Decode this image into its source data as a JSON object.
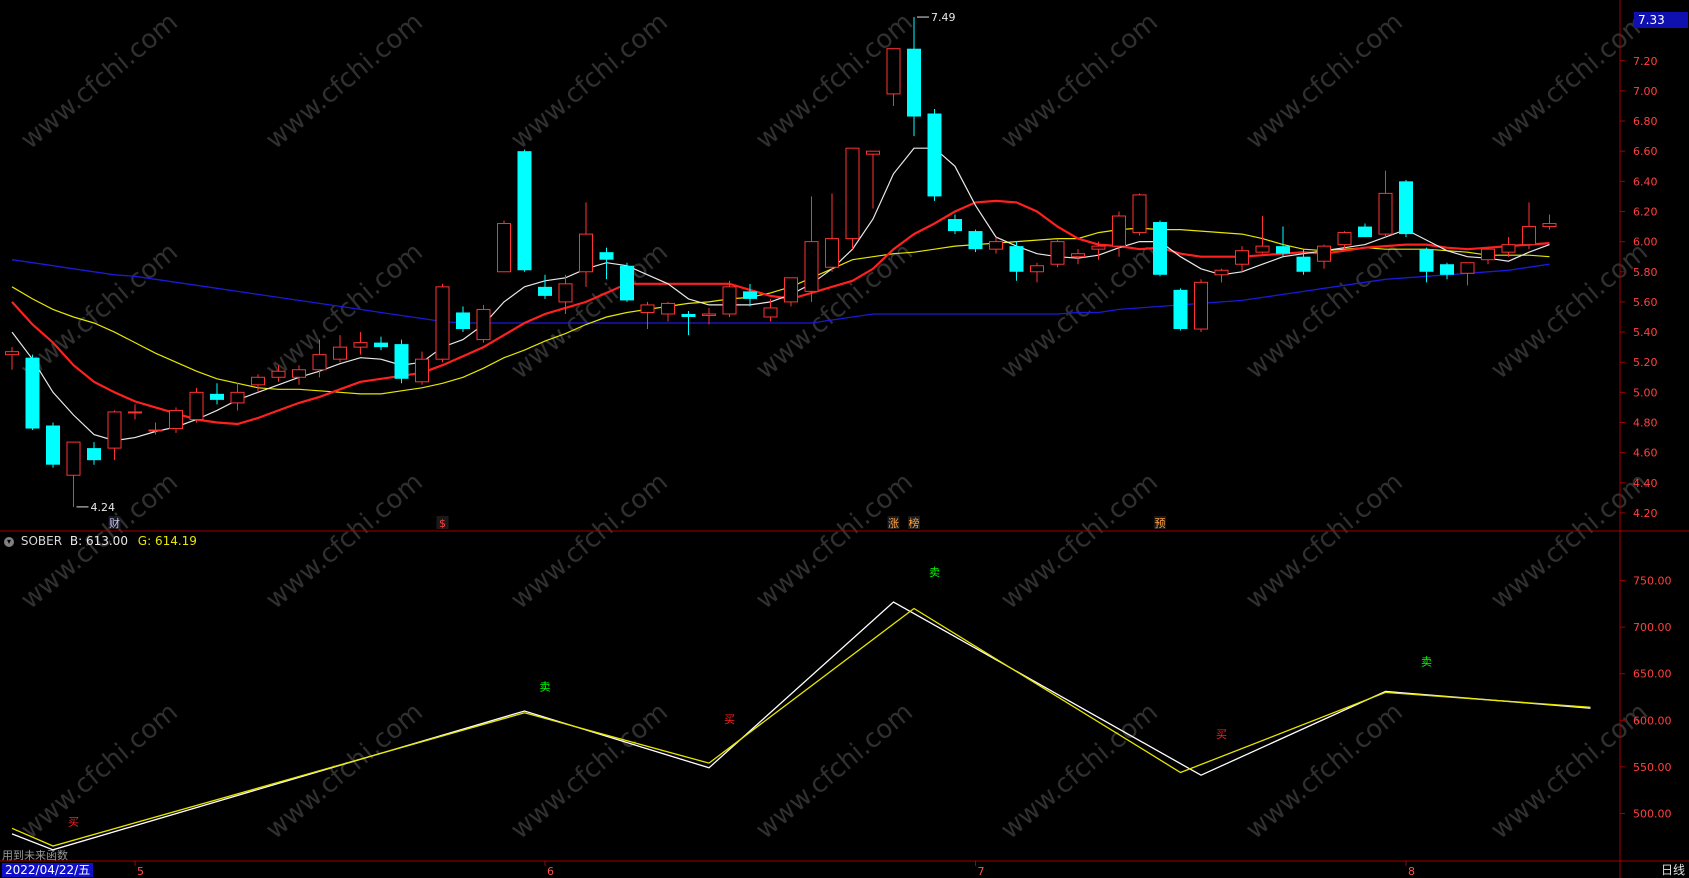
{
  "ind_header": {
    "name": "SOBER",
    "b_label": "B: 613.00",
    "g_label": "G: 614.19"
  },
  "footer": {
    "date": "2022/04/22/五",
    "hint": "用到未来函数",
    "period": "日线"
  },
  "price_tag": "7.33",
  "colors": {
    "up": "#ff3232",
    "down": "#00ffff",
    "ma5": "#e8e8e8",
    "ma10": "#ff2020",
    "ma20": "#e6e600",
    "ma60": "#1a1ad8",
    "axis": "#a00000",
    "sober_b": "#ffffff",
    "sober_g": "#e6e600",
    "buy": "#ff2020",
    "sell": "#00ff00"
  },
  "chart_data": [
    {
      "type": "candlestick",
      "title": "",
      "ylim": [
        4.1,
        7.55
      ],
      "y_ticks": [
        4.2,
        4.4,
        4.6,
        4.8,
        5.0,
        5.2,
        5.4,
        5.6,
        5.8,
        6.0,
        6.2,
        6.4,
        6.6,
        6.8,
        7.0,
        7.2
      ],
      "y_tick_labels": [
        "4.20",
        "4.40",
        "4.60",
        "4.80",
        "5.00",
        "5.20",
        "5.40",
        "5.60",
        "5.80",
        "6.00",
        "6.20",
        "6.40",
        "6.60",
        "6.80",
        "7.00",
        "7.20"
      ],
      "x_labels": [
        {
          "i": 6,
          "label": "5"
        },
        {
          "i": 26,
          "label": "6"
        },
        {
          "i": 47,
          "label": "7"
        },
        {
          "i": 68,
          "label": "8"
        }
      ],
      "candles": [
        {
          "o": 5.25,
          "h": 5.3,
          "l": 5.15,
          "c": 5.27
        },
        {
          "o": 5.23,
          "h": 5.25,
          "l": 4.75,
          "c": 4.76
        },
        {
          "o": 4.78,
          "h": 4.8,
          "l": 4.5,
          "c": 4.52
        },
        {
          "o": 4.45,
          "h": 4.67,
          "l": 4.24,
          "c": 4.67
        },
        {
          "o": 4.63,
          "h": 4.67,
          "l": 4.52,
          "c": 4.55
        },
        {
          "o": 4.63,
          "h": 4.88,
          "l": 4.55,
          "c": 4.87
        },
        {
          "o": 4.87,
          "h": 4.92,
          "l": 4.82,
          "c": 4.87
        },
        {
          "o": 4.75,
          "h": 4.8,
          "l": 4.72,
          "c": 4.75
        },
        {
          "o": 4.76,
          "h": 4.9,
          "l": 4.73,
          "c": 4.88
        },
        {
          "o": 4.82,
          "h": 5.03,
          "l": 4.8,
          "c": 5.0
        },
        {
          "o": 4.99,
          "h": 5.06,
          "l": 4.92,
          "c": 4.95
        },
        {
          "o": 4.93,
          "h": 5.06,
          "l": 4.88,
          "c": 5.0
        },
        {
          "o": 5.05,
          "h": 5.12,
          "l": 5.0,
          "c": 5.1
        },
        {
          "o": 5.1,
          "h": 5.18,
          "l": 5.07,
          "c": 5.14
        },
        {
          "o": 5.1,
          "h": 5.18,
          "l": 5.05,
          "c": 5.15
        },
        {
          "o": 5.15,
          "h": 5.35,
          "l": 5.1,
          "c": 5.25
        },
        {
          "o": 5.22,
          "h": 5.38,
          "l": 5.2,
          "c": 5.3
        },
        {
          "o": 5.3,
          "h": 5.4,
          "l": 5.25,
          "c": 5.33
        },
        {
          "o": 5.33,
          "h": 5.37,
          "l": 5.28,
          "c": 5.3
        },
        {
          "o": 5.32,
          "h": 5.35,
          "l": 5.06,
          "c": 5.09
        },
        {
          "o": 5.07,
          "h": 5.27,
          "l": 5.05,
          "c": 5.22
        },
        {
          "o": 5.22,
          "h": 5.72,
          "l": 5.2,
          "c": 5.7
        },
        {
          "o": 5.53,
          "h": 5.57,
          "l": 5.4,
          "c": 5.42
        },
        {
          "o": 5.35,
          "h": 5.58,
          "l": 5.33,
          "c": 5.55
        },
        {
          "o": 5.8,
          "h": 6.14,
          "l": 5.8,
          "c": 6.12
        },
        {
          "o": 6.6,
          "h": 6.61,
          "l": 5.8,
          "c": 5.81
        },
        {
          "o": 5.7,
          "h": 5.78,
          "l": 5.62,
          "c": 5.64
        },
        {
          "o": 5.6,
          "h": 5.78,
          "l": 5.52,
          "c": 5.72
        },
        {
          "o": 5.8,
          "h": 6.26,
          "l": 5.7,
          "c": 6.05
        },
        {
          "o": 5.93,
          "h": 5.96,
          "l": 5.75,
          "c": 5.88
        },
        {
          "o": 5.84,
          "h": 5.86,
          "l": 5.6,
          "c": 5.61
        },
        {
          "o": 5.53,
          "h": 5.6,
          "l": 5.42,
          "c": 5.58
        },
        {
          "o": 5.52,
          "h": 5.6,
          "l": 5.47,
          "c": 5.59
        },
        {
          "o": 5.52,
          "h": 5.54,
          "l": 5.38,
          "c": 5.5
        },
        {
          "o": 5.51,
          "h": 5.56,
          "l": 5.45,
          "c": 5.52
        },
        {
          "o": 5.52,
          "h": 5.74,
          "l": 5.5,
          "c": 5.7
        },
        {
          "o": 5.67,
          "h": 5.72,
          "l": 5.57,
          "c": 5.62
        },
        {
          "o": 5.5,
          "h": 5.62,
          "l": 5.47,
          "c": 5.56
        },
        {
          "o": 5.6,
          "h": 5.76,
          "l": 5.57,
          "c": 5.76
        },
        {
          "o": 5.67,
          "h": 6.3,
          "l": 5.6,
          "c": 6.0
        },
        {
          "o": 5.83,
          "h": 6.32,
          "l": 5.8,
          "c": 6.02
        },
        {
          "o": 6.02,
          "h": 6.26,
          "l": 5.95,
          "c": 6.62
        },
        {
          "o": 6.58,
          "h": 6.55,
          "l": 6.22,
          "c": 6.6
        },
        {
          "o": 6.98,
          "h": 7.28,
          "l": 6.9,
          "c": 7.28
        },
        {
          "o": 7.28,
          "h": 7.49,
          "l": 6.7,
          "c": 6.83
        },
        {
          "o": 6.85,
          "h": 6.88,
          "l": 6.27,
          "c": 6.3
        },
        {
          "o": 6.15,
          "h": 6.18,
          "l": 6.05,
          "c": 6.07
        },
        {
          "o": 6.07,
          "h": 6.08,
          "l": 5.93,
          "c": 5.95
        },
        {
          "o": 5.95,
          "h": 6.03,
          "l": 5.92,
          "c": 6.0
        },
        {
          "o": 5.97,
          "h": 6.0,
          "l": 5.74,
          "c": 5.8
        },
        {
          "o": 5.8,
          "h": 5.86,
          "l": 5.73,
          "c": 5.84
        },
        {
          "o": 5.85,
          "h": 6.02,
          "l": 5.83,
          "c": 6.0
        },
        {
          "o": 5.9,
          "h": 5.95,
          "l": 5.85,
          "c": 5.92
        },
        {
          "o": 5.95,
          "h": 6.0,
          "l": 5.88,
          "c": 5.97
        },
        {
          "o": 5.97,
          "h": 6.2,
          "l": 5.9,
          "c": 6.17
        },
        {
          "o": 6.06,
          "h": 6.32,
          "l": 6.04,
          "c": 6.31
        },
        {
          "o": 6.13,
          "h": 6.14,
          "l": 5.77,
          "c": 5.78
        },
        {
          "o": 5.68,
          "h": 5.69,
          "l": 5.41,
          "c": 5.42
        },
        {
          "o": 5.42,
          "h": 5.75,
          "l": 5.4,
          "c": 5.73
        },
        {
          "o": 5.78,
          "h": 5.82,
          "l": 5.73,
          "c": 5.81
        },
        {
          "o": 5.85,
          "h": 5.97,
          "l": 5.8,
          "c": 5.94
        },
        {
          "o": 5.93,
          "h": 6.17,
          "l": 5.92,
          "c": 5.97
        },
        {
          "o": 5.97,
          "h": 6.1,
          "l": 5.9,
          "c": 5.92
        },
        {
          "o": 5.9,
          "h": 5.95,
          "l": 5.78,
          "c": 5.8
        },
        {
          "o": 5.87,
          "h": 5.98,
          "l": 5.82,
          "c": 5.97
        },
        {
          "o": 5.98,
          "h": 6.07,
          "l": 5.95,
          "c": 6.06
        },
        {
          "o": 6.1,
          "h": 6.12,
          "l": 6.03,
          "c": 6.03
        },
        {
          "o": 6.05,
          "h": 6.47,
          "l": 6.03,
          "c": 6.32
        },
        {
          "o": 6.4,
          "h": 6.41,
          "l": 6.03,
          "c": 6.05
        },
        {
          "o": 5.95,
          "h": 5.96,
          "l": 5.73,
          "c": 5.8
        },
        {
          "o": 5.85,
          "h": 5.86,
          "l": 5.75,
          "c": 5.78
        },
        {
          "o": 5.79,
          "h": 5.86,
          "l": 5.71,
          "c": 5.86
        },
        {
          "o": 5.88,
          "h": 5.96,
          "l": 5.85,
          "c": 5.95
        },
        {
          "o": 5.93,
          "h": 6.03,
          "l": 5.9,
          "c": 5.98
        },
        {
          "o": 5.98,
          "h": 6.26,
          "l": 5.95,
          "c": 6.1
        },
        {
          "o": 6.1,
          "h": 6.18,
          "l": 6.08,
          "c": 6.12
        }
      ],
      "ma5": [
        5.4,
        5.22,
        5.0,
        4.85,
        4.72,
        4.68,
        4.7,
        4.74,
        4.77,
        4.82,
        4.88,
        4.95,
        5.0,
        5.05,
        5.1,
        5.14,
        5.19,
        5.23,
        5.22,
        5.18,
        5.2,
        5.3,
        5.35,
        5.45,
        5.6,
        5.7,
        5.74,
        5.76,
        5.82,
        5.86,
        5.84,
        5.78,
        5.72,
        5.62,
        5.58,
        5.58,
        5.58,
        5.6,
        5.65,
        5.72,
        5.82,
        5.95,
        6.15,
        6.45,
        6.62,
        6.62,
        6.5,
        6.24,
        6.03,
        5.97,
        5.92,
        5.9,
        5.89,
        5.91,
        5.96,
        6.0,
        6.0,
        5.9,
        5.82,
        5.78,
        5.8,
        5.85,
        5.9,
        5.92,
        5.94,
        5.96,
        5.98,
        6.03,
        6.08,
        6.01,
        5.94,
        5.9,
        5.89,
        5.87,
        5.93,
        5.98
      ],
      "ma10": [
        5.6,
        5.45,
        5.33,
        5.18,
        5.07,
        5.0,
        4.94,
        4.9,
        4.86,
        4.82,
        4.8,
        4.79,
        4.83,
        4.88,
        4.93,
        4.97,
        5.02,
        5.07,
        5.09,
        5.11,
        5.13,
        5.18,
        5.24,
        5.3,
        5.38,
        5.46,
        5.52,
        5.56,
        5.6,
        5.66,
        5.72,
        5.72,
        5.72,
        5.72,
        5.72,
        5.72,
        5.68,
        5.64,
        5.62,
        5.66,
        5.7,
        5.74,
        5.82,
        5.95,
        6.05,
        6.12,
        6.2,
        6.26,
        6.27,
        6.26,
        6.2,
        6.1,
        6.02,
        5.98,
        5.97,
        5.95,
        5.96,
        5.92,
        5.9,
        5.9,
        5.9,
        5.91,
        5.92,
        5.93,
        5.92,
        5.94,
        5.96,
        5.97,
        5.98,
        5.98,
        5.96,
        5.95,
        5.96,
        5.97,
        5.98,
        5.99
      ],
      "ma20": [
        5.7,
        5.62,
        5.55,
        5.5,
        5.46,
        5.4,
        5.33,
        5.26,
        5.2,
        5.14,
        5.09,
        5.06,
        5.03,
        5.02,
        5.02,
        5.01,
        5.0,
        4.99,
        4.99,
        5.01,
        5.03,
        5.06,
        5.1,
        5.16,
        5.23,
        5.28,
        5.34,
        5.39,
        5.45,
        5.5,
        5.53,
        5.55,
        5.57,
        5.59,
        5.6,
        5.62,
        5.63,
        5.66,
        5.7,
        5.76,
        5.82,
        5.88,
        5.9,
        5.92,
        5.93,
        5.95,
        5.97,
        5.98,
        5.99,
        6.0,
        6.01,
        6.02,
        6.02,
        6.06,
        6.08,
        6.09,
        6.08,
        6.08,
        6.07,
        6.06,
        6.05,
        6.02,
        5.98,
        5.95,
        5.94,
        5.95,
        5.96,
        5.95,
        5.95,
        5.95,
        5.94,
        5.93,
        5.91,
        5.91,
        5.91,
        5.9
      ],
      "ma60": [
        5.88,
        5.86,
        5.84,
        5.82,
        5.8,
        5.78,
        5.77,
        5.75,
        5.73,
        5.71,
        5.69,
        5.67,
        5.65,
        5.63,
        5.61,
        5.59,
        5.57,
        5.55,
        5.53,
        5.51,
        5.49,
        5.47,
        5.46,
        5.46,
        5.46,
        5.46,
        5.46,
        5.46,
        5.46,
        5.46,
        5.46,
        5.46,
        5.46,
        5.46,
        5.46,
        5.46,
        5.46,
        5.46,
        5.46,
        5.46,
        5.48,
        5.5,
        5.52,
        5.52,
        5.52,
        5.52,
        5.52,
        5.52,
        5.52,
        5.52,
        5.52,
        5.52,
        5.53,
        5.53,
        5.55,
        5.56,
        5.57,
        5.58,
        5.59,
        5.6,
        5.61,
        5.63,
        5.65,
        5.67,
        5.69,
        5.71,
        5.73,
        5.75,
        5.76,
        5.77,
        5.78,
        5.79,
        5.8,
        5.81,
        5.83,
        5.85
      ],
      "annotations": [
        {
          "i": 3,
          "price": 4.24,
          "label": "4.24"
        },
        {
          "i": 44,
          "price": 7.49,
          "label": "7.49"
        }
      ],
      "bottom_markers": [
        {
          "i": 5,
          "label": "财",
          "color": "#c0c0ff"
        },
        {
          "i": 21,
          "label": "$",
          "color": "#ff4040"
        },
        {
          "i": 43,
          "label": "涨",
          "color": "#ffa040"
        },
        {
          "i": 44,
          "label": "榜",
          "color": "#ffa040"
        },
        {
          "i": 56,
          "label": "预",
          "color": "#ffa040"
        }
      ]
    },
    {
      "type": "line",
      "title": "SOBER",
      "ylim": [
        450,
        785
      ],
      "y_ticks": [
        500,
        550,
        600,
        650,
        700,
        750
      ],
      "y_tick_labels": [
        "500.00",
        "550.00",
        "600.00",
        "650.00",
        "700.00",
        "750.00"
      ],
      "series": [
        {
          "name": "B",
          "points": [
            [
              0,
              478
            ],
            [
              2,
              461
            ],
            [
              25,
              610
            ],
            [
              34,
              549
            ],
            [
              43,
              727
            ],
            [
              58,
              541
            ],
            [
              67,
              631
            ],
            [
              77,
              613
            ]
          ]
        },
        {
          "name": "G",
          "points": [
            [
              0,
              484
            ],
            [
              2,
              465
            ],
            [
              25,
              608
            ],
            [
              34,
              554
            ],
            [
              44,
              720
            ],
            [
              57,
              544
            ],
            [
              67,
              630
            ],
            [
              77,
              614
            ]
          ]
        }
      ],
      "signals": [
        {
          "i": 3,
          "label": "买",
          "value": 487,
          "kind": "buy"
        },
        {
          "i": 26,
          "label": "卖",
          "value": 632,
          "kind": "sell"
        },
        {
          "i": 35,
          "label": "买",
          "value": 597,
          "kind": "buy"
        },
        {
          "i": 45,
          "label": "卖",
          "value": 755,
          "kind": "sell"
        },
        {
          "i": 59,
          "label": "买",
          "value": 581,
          "kind": "buy"
        },
        {
          "i": 69,
          "label": "卖",
          "value": 659,
          "kind": "sell"
        }
      ]
    }
  ]
}
